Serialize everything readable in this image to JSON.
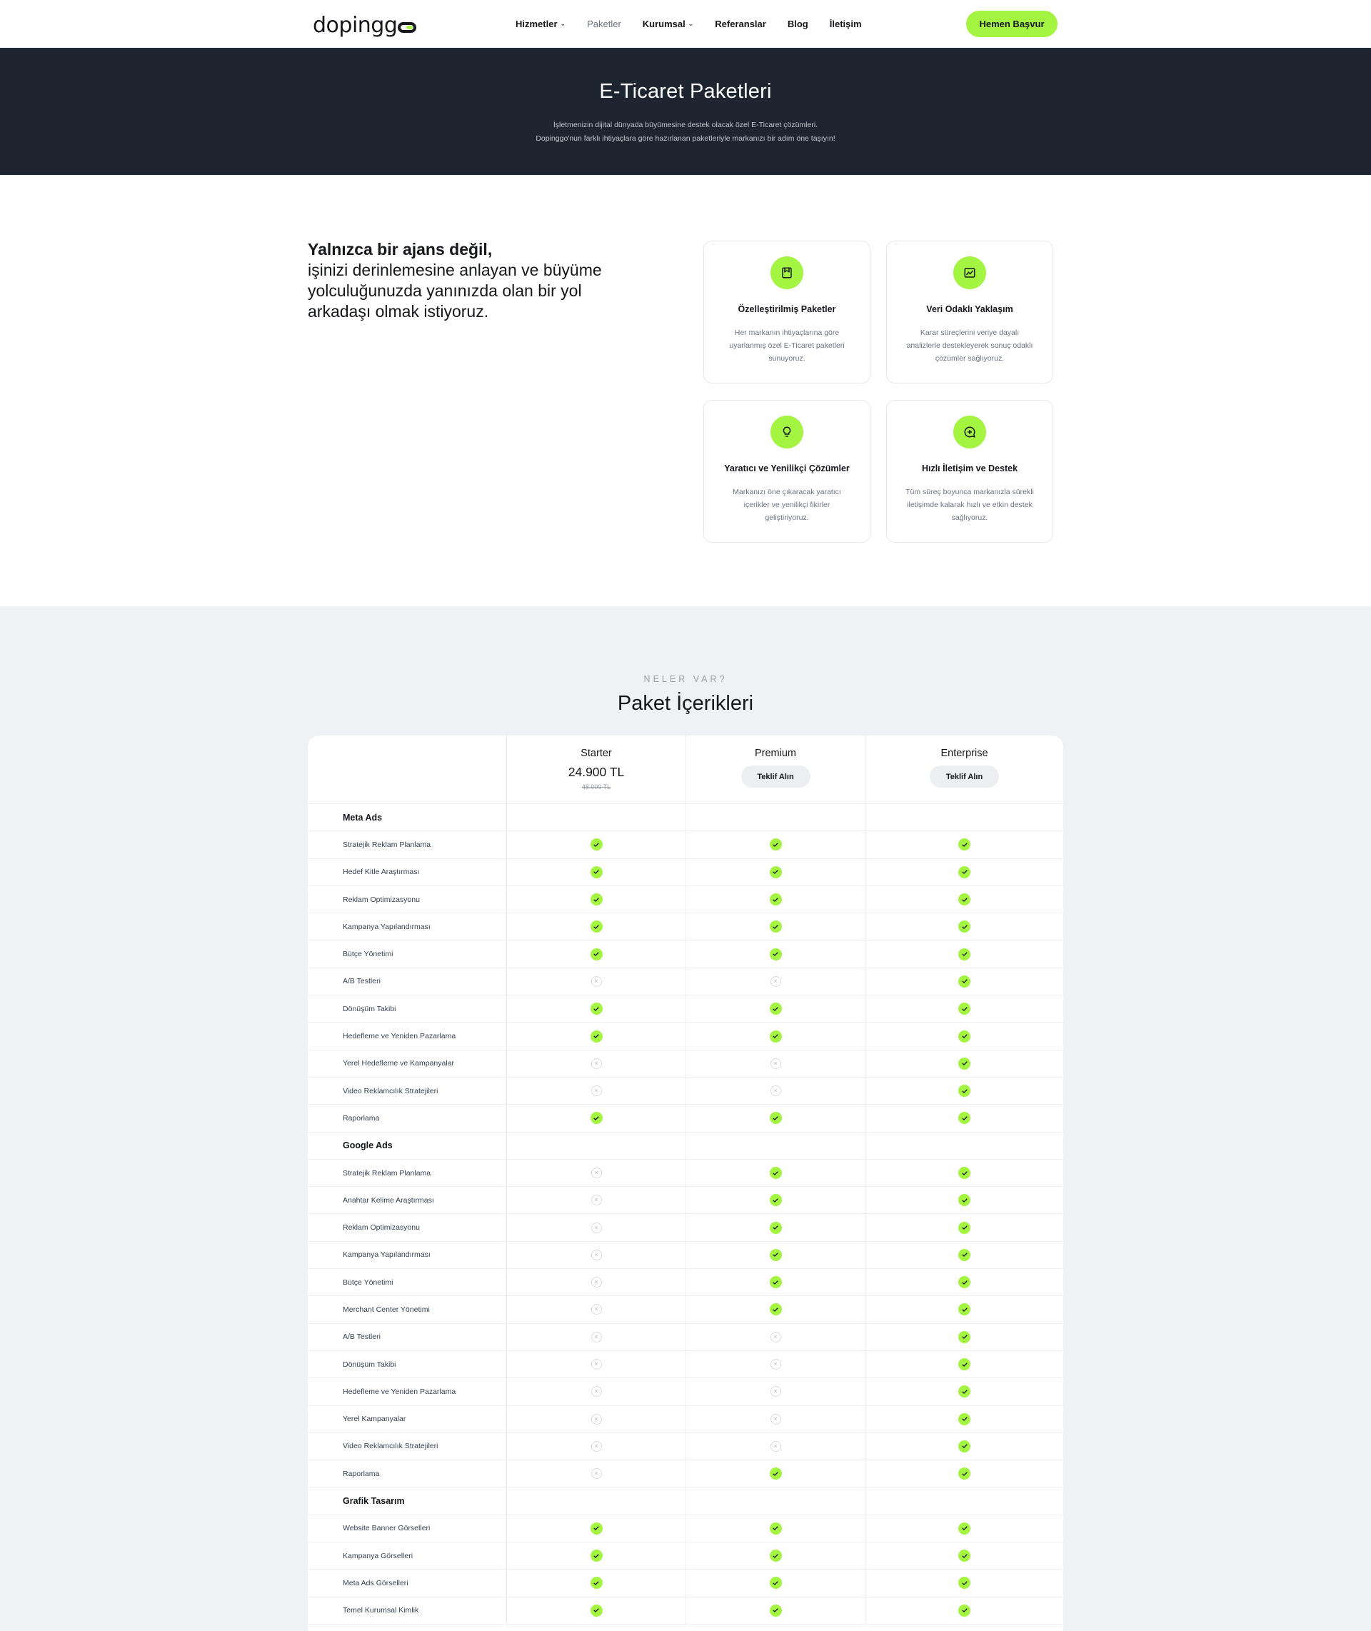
{
  "header": {
    "logo": "dopinggo",
    "nav": [
      {
        "label": "Hizmetler",
        "has_dropdown": true,
        "active": false
      },
      {
        "label": "Paketler",
        "has_dropdown": false,
        "active": true
      },
      {
        "label": "Kurumsal",
        "has_dropdown": true,
        "active": false
      },
      {
        "label": "Referanslar",
        "has_dropdown": false,
        "active": false
      },
      {
        "label": "Blog",
        "has_dropdown": false,
        "active": false
      },
      {
        "label": "İletişim",
        "has_dropdown": false,
        "active": false
      }
    ],
    "cta": "Hemen Başvur"
  },
  "hero": {
    "title": "E-Ticaret Paketleri",
    "line1": "İşletmenizin dijital dünyada büyümesine destek olacak özel E-Ticaret çözümleri.",
    "line2": "Dopinggo'nun farklı ihtiyaçlara göre hazırlanan paketleriyle markanızı bir adım öne taşıyın!"
  },
  "intro": {
    "bold": "Yalnızca bir ajans değil,",
    "rest": "işinizi derinlemesine anlayan ve büyüme yolculuğunuzda yanınızda olan bir yol arkadaşı olmak istiyoruz."
  },
  "features": [
    {
      "icon": "package-icon",
      "title": "Özelleştirilmiş Paketler",
      "desc": "Her markanın ihtiyaçlarına göre uyarlanmış özel E-Ticaret paketleri sunuyoruz."
    },
    {
      "icon": "chart-icon",
      "title": "Veri Odaklı Yaklaşım",
      "desc": "Karar süreçlerini veriye dayalı analizlerle destekleyerek sonuç odaklı çözümler sağlıyoruz."
    },
    {
      "icon": "lightbulb-icon",
      "title": "Yaratıcı ve Yenilikçi Çözümler",
      "desc": "Markanızı öne çıkaracak yaratıcı içerikler ve yenilikçi fikirler geliştiriyoruz."
    },
    {
      "icon": "chat-icon",
      "title": "Hızlı İletişim ve Destek",
      "desc": "Tüm süreç boyunca markanızla sürekli iletişimde kalarak hızlı ve etkin destek sağlıyoruz."
    }
  ],
  "packages": {
    "eyebrow": "NELER VAR?",
    "title": "Paket İçerikleri",
    "plans": [
      {
        "name": "Starter",
        "price": "24.900 TL",
        "old_price": "48.000 TL",
        "button": ""
      },
      {
        "name": "Premium",
        "price": "",
        "old_price": "",
        "button": "Teklif Alın"
      },
      {
        "name": "Enterprise",
        "price": "",
        "old_price": "",
        "button": "Teklif Alın"
      }
    ],
    "rows": [
      {
        "type": "section",
        "label": "Meta Ads"
      },
      {
        "type": "feature",
        "label": "Stratejik Reklam Planlama",
        "values": [
          true,
          true,
          true
        ]
      },
      {
        "type": "feature",
        "label": "Hedef Kitle Araştırması",
        "values": [
          true,
          true,
          true
        ]
      },
      {
        "type": "feature",
        "label": "Reklam Optimizasyonu",
        "values": [
          true,
          true,
          true
        ]
      },
      {
        "type": "feature",
        "label": "Kampanya Yapılandırması",
        "values": [
          true,
          true,
          true
        ]
      },
      {
        "type": "feature",
        "label": "Bütçe Yönetimi",
        "values": [
          true,
          true,
          true
        ]
      },
      {
        "type": "feature",
        "label": "A/B Testleri",
        "values": [
          false,
          false,
          true
        ]
      },
      {
        "type": "feature",
        "label": "Dönüşüm Takibi",
        "values": [
          true,
          true,
          true
        ]
      },
      {
        "type": "feature",
        "label": "Hedefleme ve Yeniden Pazarlama",
        "values": [
          true,
          true,
          true
        ]
      },
      {
        "type": "feature",
        "label": "Yerel Hedefleme ve Kampanyalar",
        "values": [
          false,
          false,
          true
        ]
      },
      {
        "type": "feature",
        "label": "Video Reklamcılık Stratejileri",
        "values": [
          false,
          false,
          true
        ]
      },
      {
        "type": "feature",
        "label": "Raporlama",
        "values": [
          true,
          true,
          true
        ]
      },
      {
        "type": "section",
        "label": "Google Ads"
      },
      {
        "type": "feature",
        "label": "Stratejik Reklam Planlama",
        "values": [
          false,
          true,
          true
        ]
      },
      {
        "type": "feature",
        "label": "Anahtar Kelime Araştırması",
        "values": [
          false,
          true,
          true
        ]
      },
      {
        "type": "feature",
        "label": "Reklam Optimizasyonu",
        "values": [
          false,
          true,
          true
        ]
      },
      {
        "type": "feature",
        "label": "Kampanya Yapılandırması",
        "values": [
          false,
          true,
          true
        ]
      },
      {
        "type": "feature",
        "label": "Bütçe Yönetimi",
        "values": [
          false,
          true,
          true
        ]
      },
      {
        "type": "feature",
        "label": "Merchant Center Yönetimi",
        "values": [
          false,
          true,
          true
        ]
      },
      {
        "type": "feature",
        "label": "A/B Testleri",
        "values": [
          false,
          false,
          true
        ]
      },
      {
        "type": "feature",
        "label": "Dönüşüm Takibi",
        "values": [
          false,
          false,
          true
        ]
      },
      {
        "type": "feature",
        "label": "Hedefleme ve Yeniden Pazarlama",
        "values": [
          false,
          false,
          true
        ]
      },
      {
        "type": "feature",
        "label": "Yerel Kampanyalar",
        "values": [
          false,
          false,
          true
        ]
      },
      {
        "type": "feature",
        "label": "Video Reklamcılık Stratejileri",
        "values": [
          false,
          false,
          true
        ]
      },
      {
        "type": "feature",
        "label": "Raporlama",
        "values": [
          false,
          true,
          true
        ]
      },
      {
        "type": "section",
        "label": "Grafik Tasarım"
      },
      {
        "type": "feature",
        "label": "Website Banner Görselleri",
        "values": [
          true,
          true,
          true
        ]
      },
      {
        "type": "feature",
        "label": "Kampanya Görselleri",
        "values": [
          true,
          true,
          true
        ]
      },
      {
        "type": "feature",
        "label": "Meta Ads Görselleri",
        "values": [
          true,
          true,
          true
        ]
      },
      {
        "type": "feature",
        "label": "Temel Kurumsal Kimlik",
        "values": [
          true,
          true,
          true
        ]
      }
    ]
  },
  "colors": {
    "accent": "#a3f542",
    "hero_bg": "#1d2630",
    "section_bg": "#eff1f4"
  }
}
